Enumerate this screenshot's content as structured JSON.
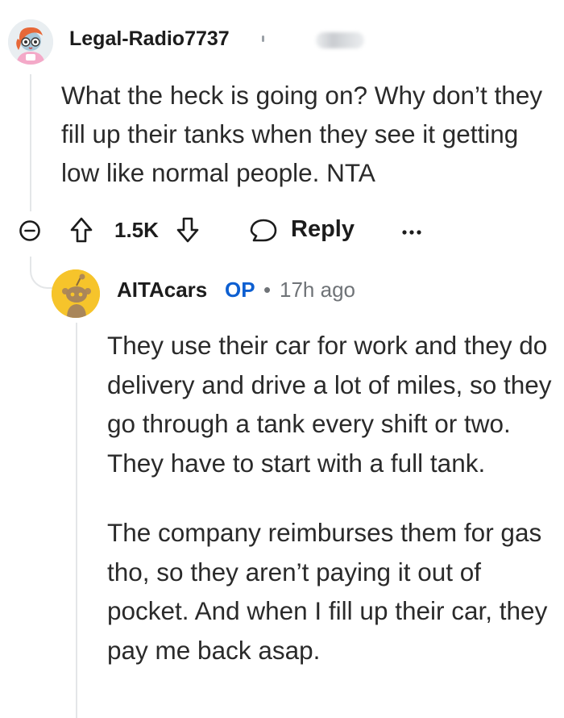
{
  "parent_comment": {
    "username": "Legal-Radio7737",
    "body": "What the heck is going on? Why don’t they fill up their tanks when they see it getting low like normal people. NTA",
    "score": "1.5K",
    "reply_label": "Reply"
  },
  "reply_comment": {
    "username": "AITAcars",
    "badge": "OP",
    "separator": "•",
    "timestamp": "17h ago",
    "paragraphs": [
      "They use their car for work and they do delivery and drive a lot of miles, so they go through a tank every shift or two. They have to start with a full tank.",
      "The company reimburses them for gas tho, so they aren’t paying it out of pocket. And when I fill up their car, they pay me back asap."
    ]
  },
  "colors": {
    "op_badge": "#0d5fd1",
    "meta_text": "#6f7377",
    "thread_line": "#e4e6e8",
    "snoo_avatar_bg": "#f6c42b"
  },
  "icons": {
    "collapse": "collapse-minus-icon",
    "upvote": "upvote-arrow-icon",
    "downvote": "downvote-arrow-icon",
    "reply": "reply-bubble-icon",
    "more": "more-options-icon"
  }
}
